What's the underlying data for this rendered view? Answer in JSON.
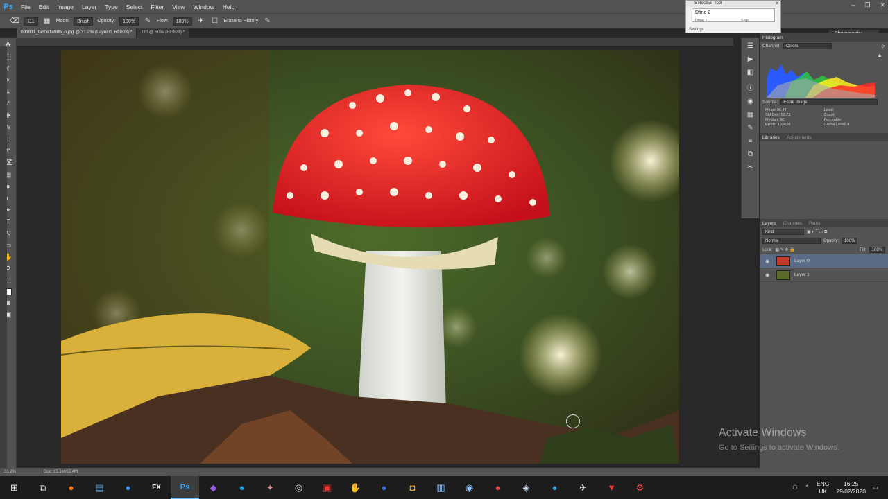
{
  "app": {
    "logo": "Ps"
  },
  "menu": [
    "File",
    "Edit",
    "Image",
    "Layer",
    "Type",
    "Select",
    "Filter",
    "View",
    "Window",
    "Help"
  ],
  "window_controls": [
    "–",
    "❐",
    "✕"
  ],
  "options": {
    "brush_size": "111",
    "mode_label": "Mode:",
    "mode_value": "Brush",
    "opacity_label": "Opacity:",
    "opacity_value": "100%",
    "flow_label": "Flow:",
    "flow_value": "100%",
    "erase_history": "Erase to History"
  },
  "workspace": "Photography",
  "selective_tool": {
    "title": "Selective Tool",
    "value": "Dfine 2",
    "sub": "Dfine 2",
    "skip": "Skip",
    "settings": "Settings"
  },
  "tabs": [
    {
      "label": "091811_fec0e1498b_o.jpg @ 31.2% (Layer 0, RGB/8) *",
      "active": true
    },
    {
      "label": "t.tif @ 50% (RGB/8) *",
      "active": false
    }
  ],
  "status": {
    "zoom": "31.2%",
    "doc": "Doc: 35.1M/65.4M"
  },
  "histogram": {
    "tabs": [
      "Histogram"
    ],
    "channel_label": "Channel:",
    "channel_value": "Colors",
    "source_label": "Source:",
    "source_value": "Entire Image",
    "stats": [
      {
        "label": "Mean:",
        "value": "96.44"
      },
      {
        "label": "Level:",
        "value": ""
      },
      {
        "label": "Std Dev:",
        "value": "63.73"
      },
      {
        "label": "Count:",
        "value": ""
      },
      {
        "label": "Median:",
        "value": "86"
      },
      {
        "label": "Percentile:",
        "value": ""
      },
      {
        "label": "Pixels:",
        "value": "192424"
      },
      {
        "label": "Cache Level:",
        "value": "4"
      }
    ]
  },
  "libraries": {
    "tabs": [
      "Libraries",
      "Adjustments"
    ]
  },
  "layers_panel": {
    "tabs": [
      "Layers",
      "Channels",
      "Paths"
    ],
    "kind": "Kind",
    "blend": "Normal",
    "opacity_label": "Opacity:",
    "opacity_value": "100%",
    "lock_label": "Lock:",
    "fill_label": "Fill:",
    "fill_value": "100%",
    "layers": [
      {
        "name": "Layer 0",
        "selected": true
      },
      {
        "name": "Layer 1",
        "selected": false
      }
    ]
  },
  "watermark": {
    "line1": "Activate Windows",
    "line2": "Go to Settings to activate Windows."
  },
  "taskbar": {
    "icons": [
      "windows-start-icon",
      "task-view-icon",
      "firefox-icon",
      "explorer-icon",
      "edge-blue-icon",
      "fx-icon",
      "photoshop-icon",
      "app-purple-icon",
      "skype-icon",
      "app-tool-icon",
      "obs-icon",
      "filezilla-icon",
      "app-red-icon",
      "app-blue-icon",
      "app-yellow-icon",
      "notepad-icon",
      "steam-icon",
      "chrome-icon",
      "app-green-icon",
      "edge-icon",
      "app-gear-icon",
      "vivaldi-icon",
      "app-last-icon"
    ],
    "labels": {
      "fx-icon": "FX",
      "photoshop-icon": "Ps"
    },
    "lang": "ENG",
    "region": "UK",
    "time": "16:25",
    "date": "29/02/2020"
  }
}
